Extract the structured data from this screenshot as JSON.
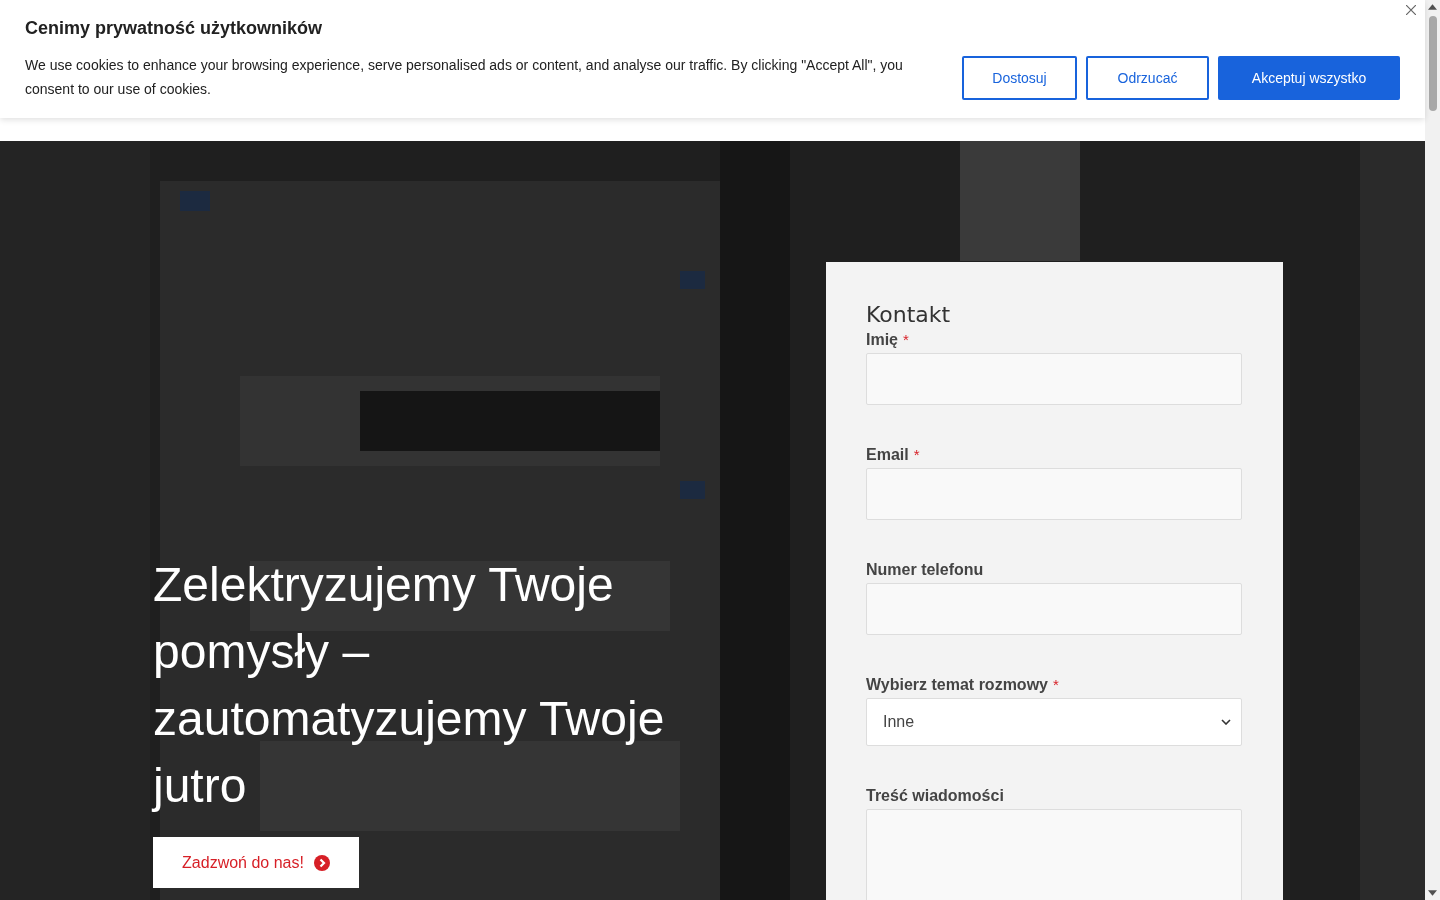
{
  "cookie_banner": {
    "title": "Cenimy prywatność użytkowników",
    "message": "We use cookies to enhance your browsing experience, serve personalised ads or content, and analyse our traffic. By clicking \"Accept All\", you consent to our use of cookies.",
    "buttons": [
      {
        "label": "Dostosuj",
        "kind": "outline"
      },
      {
        "label": "Odrzucać",
        "kind": "outline"
      },
      {
        "label": "Akceptuj wszystko",
        "kind": "primary"
      }
    ]
  },
  "hero": {
    "heading": "Zelektryzujemy Twoje pomysły – zautomatyzujemy Twoje jutro",
    "call_button": "Zadzwoń do nas!"
  },
  "contact_form": {
    "title": "Kontakt",
    "fields": [
      {
        "label": "Imię",
        "required_mark": "*",
        "kind": "text"
      },
      {
        "label": "Email",
        "required_mark": "*",
        "kind": "text"
      },
      {
        "label": "Numer telefonu",
        "kind": "text"
      },
      {
        "label": "Wybierz temat rozmowy",
        "required_mark": "*",
        "kind": "select",
        "value": "Inne"
      },
      {
        "label": "Treść wiadomości",
        "kind": "textarea"
      }
    ]
  }
}
